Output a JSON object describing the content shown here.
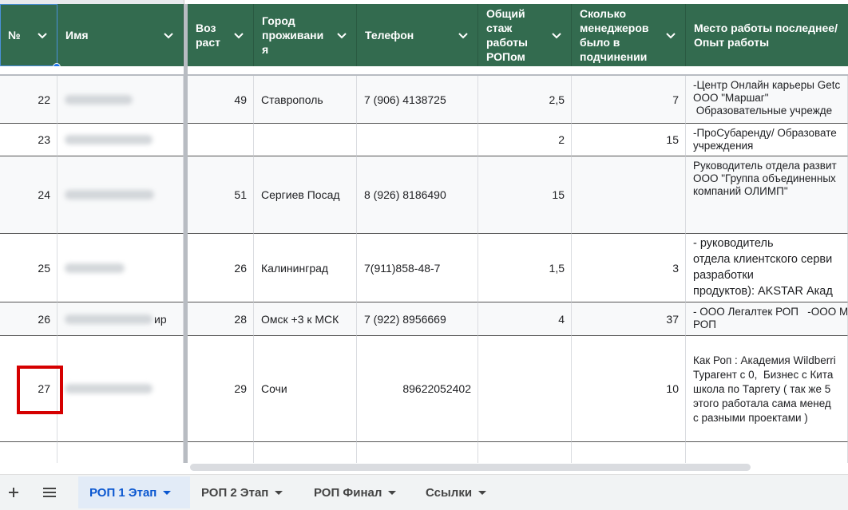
{
  "headers": [
    {
      "key": "no",
      "label": "№"
    },
    {
      "key": "name",
      "label": "Имя"
    },
    {
      "key": "age",
      "label": "Воз\nраст"
    },
    {
      "key": "city",
      "label": "Город\nпроживани\nя"
    },
    {
      "key": "phone",
      "label": "Телефон"
    },
    {
      "key": "exp",
      "label": "Общий\nстаж\nработы\nРОПом"
    },
    {
      "key": "mgr",
      "label": "Сколько\nменеджеров\nбыло в\nподчинении"
    },
    {
      "key": "work",
      "label": "Место работы последнее/\nОпыт работы"
    }
  ],
  "rows": [
    {
      "no": "22",
      "age": "49",
      "city": "Ставрополь",
      "phone": "7 (906) 4138725",
      "exp": "2,5",
      "mgr": "7",
      "work": "-Центр Онлайн карьеры Getc\nООО \"Маршаг\"\n Образовательные учрежде"
    },
    {
      "no": "23",
      "age": "",
      "city": "",
      "phone": "",
      "exp": "2",
      "mgr": "15",
      "work": "-ПроСубаренду/ Образовате\nучреждения"
    },
    {
      "no": "24",
      "age": "51",
      "city": "Сергиев Посад",
      "phone": "8 (926) 8186490",
      "exp": "15",
      "mgr": "",
      "work": "Руководитель отдела развит\nООО \"Группа объединенных\nкомпаний ОЛИМП\""
    },
    {
      "no": "25",
      "age": "26",
      "city": "Калининград",
      "phone": "7(911)858-48-7",
      "exp": "1,5",
      "mgr": "3",
      "work": "- руководитель\nотдела клиентского серви\nразработки\nпродуктов): AKSTAR Акад"
    },
    {
      "no": "26",
      "name_suffix": "ир",
      "age": "28",
      "city": "Омск +3 к МСК",
      "phone": "7 (922) 8956669",
      "exp": "4",
      "mgr": "37",
      "work": "- ООО Легалтек РОП   -ООО М\nРОП"
    },
    {
      "no": "27",
      "age": "29",
      "city": "Сочи",
      "phone": "89622052402",
      "exp": "",
      "mgr": "10",
      "work": "Как Роп : Академия Wildberri\nТурагент с 0,  Бизнес с Кита\nшкола по Таргету ( так же 5\nэтого работала сама менед\nс разными проектами )"
    }
  ],
  "tabs": [
    {
      "label": "РОП 1 Этап",
      "active": true
    },
    {
      "label": "РОП 2 Этап",
      "active": false
    },
    {
      "label": "РОП Финал",
      "active": false
    },
    {
      "label": "Ссылки",
      "active": false
    }
  ],
  "icons": {
    "add": "plus-icon",
    "list": "hamburger-menu-icon",
    "sort": "chevron-down-icon"
  },
  "colors": {
    "header_bg": "#336b4f",
    "active_tab": "#0b57d0",
    "highlight": "#d50000"
  }
}
